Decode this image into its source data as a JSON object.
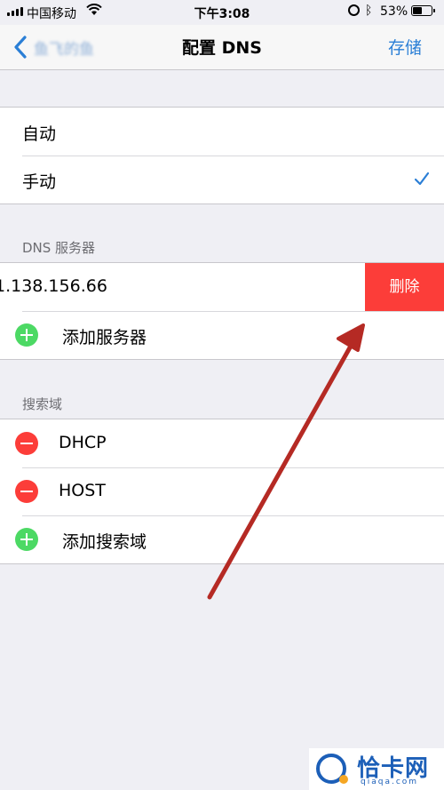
{
  "status_bar": {
    "carrier": "中国移动",
    "time": "下午3:08",
    "battery_percent": "53%",
    "battery_level": 0.53
  },
  "nav": {
    "back_label": "鱼飞的鱼",
    "title": "配置 DNS",
    "save_label": "存储"
  },
  "mode_options": [
    {
      "label": "自动",
      "selected": false
    },
    {
      "label": "手动",
      "selected": true
    }
  ],
  "dns_section": {
    "header": "DNS 服务器",
    "server_ip": "1.138.156.66",
    "delete_label": "删除",
    "add_label": "添加服务器"
  },
  "search_section": {
    "header": "搜索域",
    "domains": [
      "DHCP",
      "HOST"
    ],
    "add_label": "添加搜索域"
  },
  "watermark": {
    "brand": "恰卡网",
    "url": "qiaqa.com"
  },
  "colors": {
    "accent": "#2b7fd6",
    "delete_red": "#fc3d39",
    "add_green": "#4cd964",
    "annotation_arrow": "#b52a24"
  }
}
